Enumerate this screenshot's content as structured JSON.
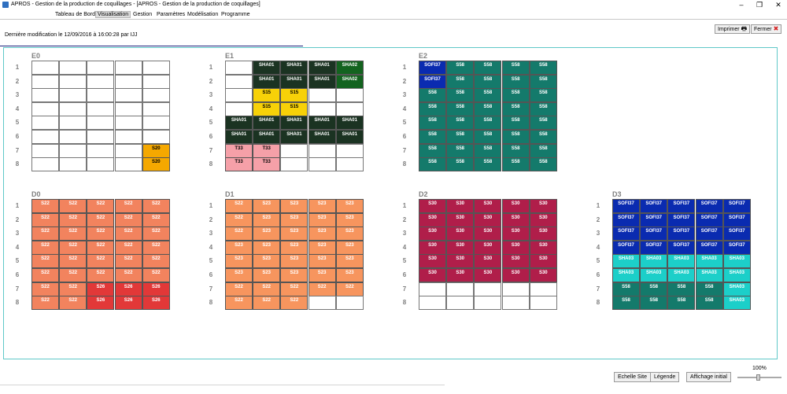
{
  "window": {
    "title": "APROS - Gestion de la production de coquillages - [APROS - Gestion de la production de coquillages]",
    "minimize": "–",
    "maximize": "❐",
    "close": "✕"
  },
  "menu": [
    "Tableau de Bord",
    "Visualisation",
    "Gestion",
    "Paramètres",
    "Modélisation",
    "Programme"
  ],
  "last_modified": "Dernière modification le 12/09/2016 à 16:00:28 par IJJ",
  "toolbar": {
    "print": "Imprimer",
    "close": "Fermer"
  },
  "bottom": {
    "echelle": "Echelle Site",
    "legende": "Légende",
    "affichage": "Affichage initial",
    "zoom": "100%"
  },
  "colors": {
    "white": "#ffffff",
    "orange": "#f5a800",
    "darkgreen": "#1b3322",
    "green": "#13631f",
    "yellow": "#f7d108",
    "pink": "#f5a0a8",
    "teal": "#147a6b",
    "blue": "#0a2bb0",
    "salmon": "#f2835e",
    "lightsalmon": "#f7955e",
    "red": "#e23838",
    "crimson": "#b01e4a",
    "cyan": "#1ccfc9"
  },
  "grids": [
    {
      "name": "E0",
      "rows": [
        [
          [
            ""
          ],
          [
            ""
          ],
          [
            ""
          ],
          [
            ""
          ],
          [
            ""
          ]
        ],
        [
          [
            ""
          ],
          [
            ""
          ],
          [
            ""
          ],
          [
            ""
          ],
          [
            ""
          ]
        ],
        [
          [
            ""
          ],
          [
            ""
          ],
          [
            ""
          ],
          [
            ""
          ],
          [
            ""
          ]
        ],
        [
          [
            ""
          ],
          [
            ""
          ],
          [
            ""
          ],
          [
            ""
          ],
          [
            ""
          ]
        ],
        [
          [
            ""
          ],
          [
            ""
          ],
          [
            ""
          ],
          [
            ""
          ],
          [
            ""
          ]
        ],
        [
          [
            ""
          ],
          [
            ""
          ],
          [
            ""
          ],
          [
            ""
          ],
          [
            ""
          ]
        ],
        [
          [
            ""
          ],
          [
            ""
          ],
          [
            ""
          ],
          [
            ""
          ],
          [
            "S20",
            "orange"
          ]
        ],
        [
          [
            ""
          ],
          [
            ""
          ],
          [
            ""
          ],
          [
            ""
          ],
          [
            "S20",
            "orange"
          ]
        ]
      ]
    },
    {
      "name": "E1",
      "rows": [
        [
          [
            ""
          ],
          [
            "SHA01",
            "darkgreen"
          ],
          [
            "SHA01",
            "darkgreen"
          ],
          [
            "SHA01",
            "darkgreen"
          ],
          [
            "SHA02",
            "green"
          ]
        ],
        [
          [
            ""
          ],
          [
            "SHA01",
            "darkgreen"
          ],
          [
            "SHA01",
            "darkgreen"
          ],
          [
            "SHA01",
            "darkgreen"
          ],
          [
            "SHA02",
            "green"
          ]
        ],
        [
          [
            ""
          ],
          [
            "S15",
            "yellow"
          ],
          [
            "S15",
            "yellow"
          ],
          [
            ""
          ],
          [
            ""
          ]
        ],
        [
          [
            ""
          ],
          [
            "S15",
            "yellow"
          ],
          [
            "S15",
            "yellow"
          ],
          [
            ""
          ],
          [
            ""
          ]
        ],
        [
          [
            "SHA01",
            "darkgreen"
          ],
          [
            "SHA01",
            "darkgreen"
          ],
          [
            "SHA01",
            "darkgreen"
          ],
          [
            "SHA01",
            "darkgreen"
          ],
          [
            "SHA01",
            "darkgreen"
          ]
        ],
        [
          [
            "SHA01",
            "darkgreen"
          ],
          [
            "SHA01",
            "darkgreen"
          ],
          [
            "SHA01",
            "darkgreen"
          ],
          [
            "SHA01",
            "darkgreen"
          ],
          [
            "SHA01",
            "darkgreen"
          ]
        ],
        [
          [
            "T33",
            "pink"
          ],
          [
            "T33",
            "pink"
          ],
          [
            ""
          ],
          [
            ""
          ],
          [
            ""
          ]
        ],
        [
          [
            "T33",
            "pink"
          ],
          [
            "T33",
            "pink"
          ],
          [
            ""
          ],
          [
            ""
          ],
          [
            ""
          ]
        ]
      ]
    },
    {
      "name": "E2",
      "rows": [
        [
          [
            "SOFI37",
            "blue"
          ],
          [
            "S58",
            "teal"
          ],
          [
            "S58",
            "teal"
          ],
          [
            "S58",
            "teal"
          ],
          [
            "S58",
            "teal"
          ]
        ],
        [
          [
            "SOFI37",
            "blue"
          ],
          [
            "S58",
            "teal"
          ],
          [
            "S58",
            "teal"
          ],
          [
            "S58",
            "teal"
          ],
          [
            "S58",
            "teal"
          ]
        ],
        [
          [
            "S58",
            "teal"
          ],
          [
            "S58",
            "teal"
          ],
          [
            "S58",
            "teal"
          ],
          [
            "S58",
            "teal"
          ],
          [
            "S58",
            "teal"
          ]
        ],
        [
          [
            "S58",
            "teal"
          ],
          [
            "S58",
            "teal"
          ],
          [
            "S58",
            "teal"
          ],
          [
            "S58",
            "teal"
          ],
          [
            "S58",
            "teal"
          ]
        ],
        [
          [
            "S58",
            "teal"
          ],
          [
            "S58",
            "teal"
          ],
          [
            "S58",
            "teal"
          ],
          [
            "S58",
            "teal"
          ],
          [
            "S58",
            "teal"
          ]
        ],
        [
          [
            "S58",
            "teal"
          ],
          [
            "S58",
            "teal"
          ],
          [
            "S58",
            "teal"
          ],
          [
            "S58",
            "teal"
          ],
          [
            "S58",
            "teal"
          ]
        ],
        [
          [
            "S58",
            "teal"
          ],
          [
            "S58",
            "teal"
          ],
          [
            "S58",
            "teal"
          ],
          [
            "S58",
            "teal"
          ],
          [
            "S58",
            "teal"
          ]
        ],
        [
          [
            "S58",
            "teal"
          ],
          [
            "S58",
            "teal"
          ],
          [
            "S58",
            "teal"
          ],
          [
            "S58",
            "teal"
          ],
          [
            "S58",
            "teal"
          ]
        ]
      ]
    },
    {
      "name": "D0",
      "rows": [
        [
          [
            "S22",
            "salmon"
          ],
          [
            "S22",
            "salmon"
          ],
          [
            "S22",
            "salmon"
          ],
          [
            "S22",
            "salmon"
          ],
          [
            "S22",
            "salmon"
          ]
        ],
        [
          [
            "S22",
            "salmon"
          ],
          [
            "S22",
            "salmon"
          ],
          [
            "S22",
            "salmon"
          ],
          [
            "S22",
            "salmon"
          ],
          [
            "S22",
            "salmon"
          ]
        ],
        [
          [
            "S22",
            "salmon"
          ],
          [
            "S22",
            "salmon"
          ],
          [
            "S22",
            "salmon"
          ],
          [
            "S22",
            "salmon"
          ],
          [
            "S22",
            "salmon"
          ]
        ],
        [
          [
            "S22",
            "salmon"
          ],
          [
            "S22",
            "salmon"
          ],
          [
            "S22",
            "salmon"
          ],
          [
            "S22",
            "salmon"
          ],
          [
            "S22",
            "salmon"
          ]
        ],
        [
          [
            "S22",
            "salmon"
          ],
          [
            "S22",
            "salmon"
          ],
          [
            "S22",
            "salmon"
          ],
          [
            "S22",
            "salmon"
          ],
          [
            "S22",
            "salmon"
          ]
        ],
        [
          [
            "S22",
            "salmon"
          ],
          [
            "S22",
            "salmon"
          ],
          [
            "S22",
            "salmon"
          ],
          [
            "S22",
            "salmon"
          ],
          [
            "S22",
            "salmon"
          ]
        ],
        [
          [
            "S22",
            "salmon"
          ],
          [
            "S22",
            "salmon"
          ],
          [
            "S26",
            "red"
          ],
          [
            "S26",
            "red"
          ],
          [
            "S26",
            "red"
          ]
        ],
        [
          [
            "S22",
            "salmon"
          ],
          [
            "S22",
            "salmon"
          ],
          [
            "S26",
            "red"
          ],
          [
            "S26",
            "red"
          ],
          [
            "S26",
            "red"
          ]
        ]
      ]
    },
    {
      "name": "D1",
      "rows": [
        [
          [
            "S22",
            "lightsalmon"
          ],
          [
            "S23",
            "lightsalmon"
          ],
          [
            "S23",
            "lightsalmon"
          ],
          [
            "S23",
            "lightsalmon"
          ],
          [
            "S23",
            "lightsalmon"
          ]
        ],
        [
          [
            "S22",
            "lightsalmon"
          ],
          [
            "S23",
            "lightsalmon"
          ],
          [
            "S23",
            "lightsalmon"
          ],
          [
            "S23",
            "lightsalmon"
          ],
          [
            "S23",
            "lightsalmon"
          ]
        ],
        [
          [
            "S22",
            "lightsalmon"
          ],
          [
            "S23",
            "lightsalmon"
          ],
          [
            "S23",
            "lightsalmon"
          ],
          [
            "S23",
            "lightsalmon"
          ],
          [
            "S23",
            "lightsalmon"
          ]
        ],
        [
          [
            "S23",
            "lightsalmon"
          ],
          [
            "S23",
            "lightsalmon"
          ],
          [
            "S23",
            "lightsalmon"
          ],
          [
            "S23",
            "lightsalmon"
          ],
          [
            "S23",
            "lightsalmon"
          ]
        ],
        [
          [
            "S23",
            "lightsalmon"
          ],
          [
            "S23",
            "lightsalmon"
          ],
          [
            "S23",
            "lightsalmon"
          ],
          [
            "S23",
            "lightsalmon"
          ],
          [
            "S23",
            "lightsalmon"
          ]
        ],
        [
          [
            "S23",
            "lightsalmon"
          ],
          [
            "S23",
            "lightsalmon"
          ],
          [
            "S23",
            "lightsalmon"
          ],
          [
            "S23",
            "lightsalmon"
          ],
          [
            "S23",
            "lightsalmon"
          ]
        ],
        [
          [
            "S22",
            "lightsalmon"
          ],
          [
            "S22",
            "lightsalmon"
          ],
          [
            "S22",
            "lightsalmon"
          ],
          [
            "S22",
            "lightsalmon"
          ],
          [
            "S22",
            "lightsalmon"
          ]
        ],
        [
          [
            "S22",
            "lightsalmon"
          ],
          [
            "S22",
            "lightsalmon"
          ],
          [
            "S22",
            "lightsalmon"
          ],
          [
            ""
          ],
          [
            ""
          ]
        ]
      ]
    },
    {
      "name": "D2",
      "rows": [
        [
          [
            "S30",
            "crimson"
          ],
          [
            "S30",
            "crimson"
          ],
          [
            "S30",
            "crimson"
          ],
          [
            "S30",
            "crimson"
          ],
          [
            "S30",
            "crimson"
          ]
        ],
        [
          [
            "S30",
            "crimson"
          ],
          [
            "S30",
            "crimson"
          ],
          [
            "S30",
            "crimson"
          ],
          [
            "S30",
            "crimson"
          ],
          [
            "S30",
            "crimson"
          ]
        ],
        [
          [
            "S30",
            "crimson"
          ],
          [
            "S30",
            "crimson"
          ],
          [
            "S30",
            "crimson"
          ],
          [
            "S30",
            "crimson"
          ],
          [
            "S30",
            "crimson"
          ]
        ],
        [
          [
            "S30",
            "crimson"
          ],
          [
            "S30",
            "crimson"
          ],
          [
            "S30",
            "crimson"
          ],
          [
            "S30",
            "crimson"
          ],
          [
            "S30",
            "crimson"
          ]
        ],
        [
          [
            "S30",
            "crimson"
          ],
          [
            "S30",
            "crimson"
          ],
          [
            "S30",
            "crimson"
          ],
          [
            "S30",
            "crimson"
          ],
          [
            "S30",
            "crimson"
          ]
        ],
        [
          [
            "S30",
            "crimson"
          ],
          [
            "S30",
            "crimson"
          ],
          [
            "S30",
            "crimson"
          ],
          [
            "S30",
            "crimson"
          ],
          [
            "S30",
            "crimson"
          ]
        ],
        [
          [
            ""
          ],
          [
            ""
          ],
          [
            ""
          ],
          [
            ""
          ],
          [
            ""
          ]
        ],
        [
          [
            ""
          ],
          [
            ""
          ],
          [
            ""
          ],
          [
            ""
          ],
          [
            ""
          ]
        ]
      ]
    },
    {
      "name": "D3",
      "rows": [
        [
          [
            "SOFI37",
            "blue"
          ],
          [
            "SOFI37",
            "blue"
          ],
          [
            "SOFI37",
            "blue"
          ],
          [
            "SOFI37",
            "blue"
          ],
          [
            "SOFI37",
            "blue"
          ]
        ],
        [
          [
            "SOFI37",
            "blue"
          ],
          [
            "SOFI37",
            "blue"
          ],
          [
            "SOFI37",
            "blue"
          ],
          [
            "SOFI37",
            "blue"
          ],
          [
            "SOFI37",
            "blue"
          ]
        ],
        [
          [
            "SOFI37",
            "blue"
          ],
          [
            "SOFI37",
            "blue"
          ],
          [
            "SOFI37",
            "blue"
          ],
          [
            "SOFI37",
            "blue"
          ],
          [
            "SOFI37",
            "blue"
          ]
        ],
        [
          [
            "SOFI37",
            "blue"
          ],
          [
            "SOFI37",
            "blue"
          ],
          [
            "SOFI37",
            "blue"
          ],
          [
            "SOFI37",
            "blue"
          ],
          [
            "SOFI37",
            "blue"
          ]
        ],
        [
          [
            "SHA03",
            "cyan"
          ],
          [
            "SHA03",
            "cyan"
          ],
          [
            "SHA03",
            "cyan"
          ],
          [
            "SHA03",
            "cyan"
          ],
          [
            "SHA03",
            "cyan"
          ]
        ],
        [
          [
            "SHA03",
            "cyan"
          ],
          [
            "SHA03",
            "cyan"
          ],
          [
            "SHA03",
            "cyan"
          ],
          [
            "SHA03",
            "cyan"
          ],
          [
            "SHA03",
            "cyan"
          ]
        ],
        [
          [
            "S58",
            "teal"
          ],
          [
            "S58",
            "teal"
          ],
          [
            "S58",
            "teal"
          ],
          [
            "S58",
            "teal"
          ],
          [
            "SHA03",
            "cyan"
          ]
        ],
        [
          [
            "S58",
            "teal"
          ],
          [
            "S58",
            "teal"
          ],
          [
            "S58",
            "teal"
          ],
          [
            "S58",
            "teal"
          ],
          [
            "SHA03",
            "cyan"
          ]
        ]
      ]
    }
  ]
}
